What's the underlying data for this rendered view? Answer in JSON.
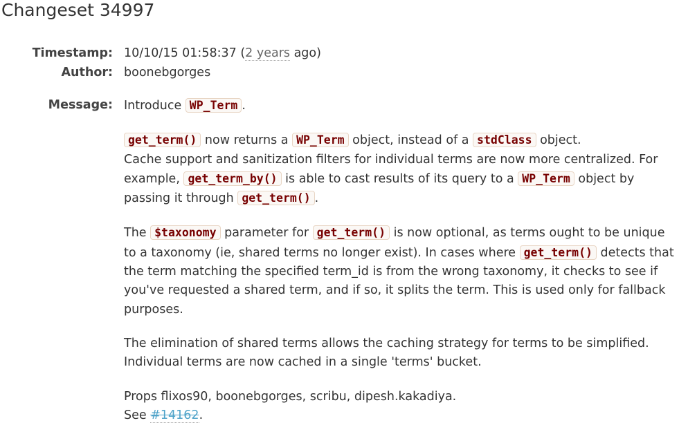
{
  "title": "Changeset 34997",
  "timestamp_label": "Timestamp:",
  "timestamp": "10/10/15 01:58:37 (",
  "timestamp_ago": "2 years",
  "timestamp_tail": " ago)",
  "author_label": "Author:",
  "author": "boonebgorges",
  "message_label": "Message:",
  "message": {
    "p0": [
      "Introduce ",
      "WP_Term",
      "."
    ],
    "p1": [
      "get_term()",
      " now returns a ",
      "WP_Term",
      " object, instead of a ",
      "stdClass",
      " object.",
      "Cache support and sanitization filters for individual terms are now more centralized. For example, ",
      "get_term_by()",
      " is able to cast results of its query to a ",
      "WP_Term",
      " object by passing it through ",
      "get_term()",
      "."
    ],
    "p2": [
      "The ",
      "$taxonomy",
      " parameter for ",
      "get_term()",
      " is now optional, as terms ought to be unique to a taxonomy (ie, shared terms no longer exist). In cases where ",
      "get_term()",
      " detects that the term matching the specified term_id is from the wrong taxonomy, it checks to see if you've requested a shared term, and if so, it splits the term. This is used only for fallback purposes."
    ],
    "p3": "The elimination of shared terms allows the caching strategy for terms to be simplified. Individual terms are now cached in a single 'terms' bucket.",
    "p4": [
      "Props flixos90, boonebgorges, scribu, dipesh.kakadiya.",
      "See ",
      "#14162",
      "."
    ]
  }
}
